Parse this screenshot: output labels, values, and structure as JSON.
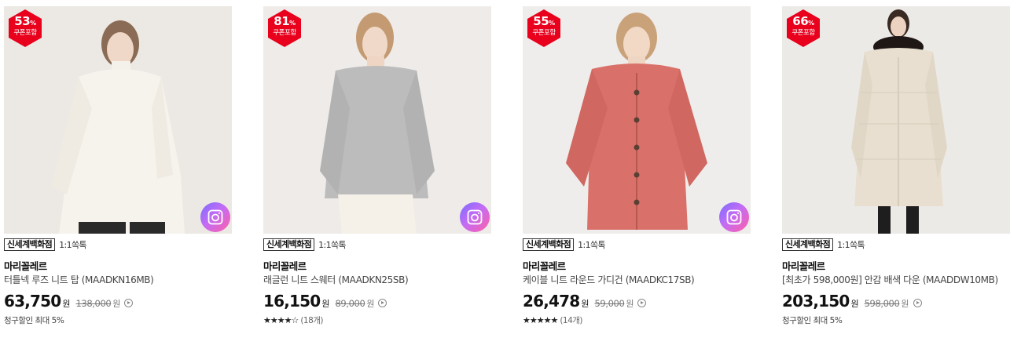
{
  "colors": {
    "badge_red": "#e8001c",
    "price_text": "#111111"
  },
  "products": [
    {
      "discount": "53",
      "percent_sign": "%",
      "coupon_label": "쿠폰포함",
      "store": "신세계백화점",
      "talk": "1:1쏙톡",
      "brand": "마리꼴레르",
      "title": "터틀넥 루즈 니트 탑 (MAADKN16MB)",
      "price": "63,750",
      "price_unit": "원",
      "original_price": "138,000",
      "original_unit": "원",
      "extra_text": "청구할인 최대 5%",
      "image_icon": "woman-white-turtleneck",
      "camera_icon": "camera-icon"
    },
    {
      "discount": "81",
      "percent_sign": "%",
      "coupon_label": "쿠폰포함",
      "store": "신세계백화점",
      "talk": "1:1쏙톡",
      "brand": "마리꼴레르",
      "title": "래글런 니트 스웨터 (MAADKN25SB)",
      "price": "16,150",
      "price_unit": "원",
      "original_price": "89,000",
      "original_unit": "원",
      "stars": "★★★★☆",
      "rating": 4,
      "reviews": "(18개)",
      "image_icon": "woman-grey-sweater",
      "camera_icon": "camera-icon"
    },
    {
      "discount": "55",
      "percent_sign": "%",
      "coupon_label": "쿠폰포함",
      "store": "신세계백화점",
      "talk": "1:1쏙톡",
      "brand": "마리꼴레르",
      "title": "케이블 니트 라운드 가디건 (MAADKC17SB)",
      "price": "26,478",
      "price_unit": "원",
      "original_price": "59,000",
      "original_unit": "원",
      "stars": "★★★★★",
      "rating": 4.5,
      "reviews": "(14개)",
      "image_icon": "woman-coral-cardigan",
      "camera_icon": "camera-icon"
    },
    {
      "discount": "66",
      "percent_sign": "%",
      "coupon_label": "쿠폰포함",
      "store": "신세계백화점",
      "talk": "1:1쏙톡",
      "brand": "마리꼴레르",
      "title": "[최초가 598,000원] 안감 배색 다운 (MAADDW10MB)",
      "price": "203,150",
      "price_unit": "원",
      "original_price": "598,000",
      "original_unit": "원",
      "extra_text": "청구할인 최대 5%",
      "image_icon": "woman-down-coat",
      "camera_icon": null
    }
  ]
}
